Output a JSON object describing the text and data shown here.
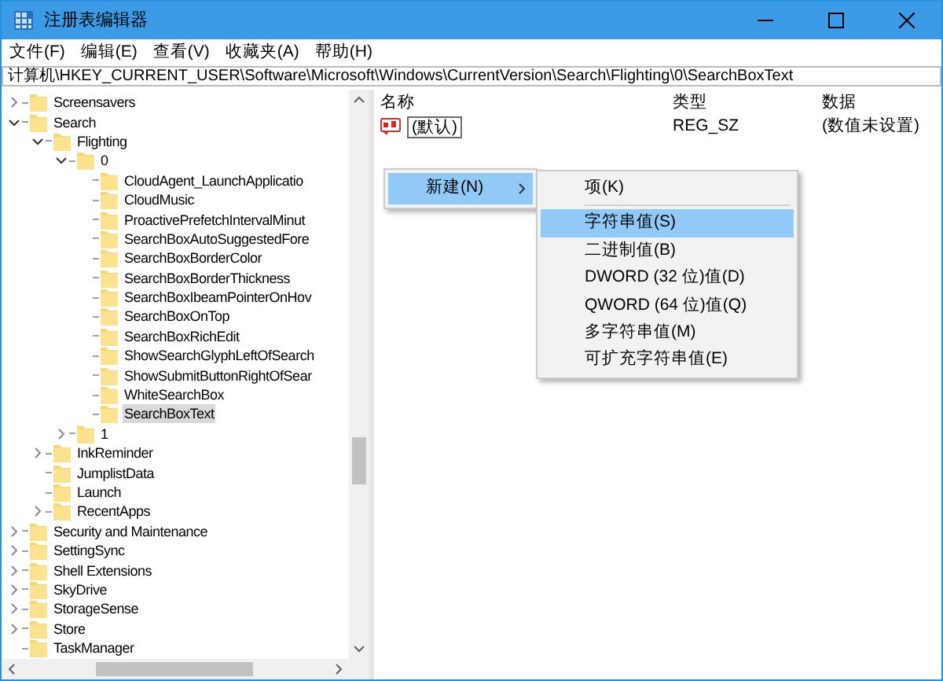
{
  "window": {
    "title": "注册表编辑器"
  },
  "menu_bar": [
    "文件(F)",
    "编辑(E)",
    "查看(V)",
    "收藏夹(A)",
    "帮助(H)"
  ],
  "address": "计算机\\HKEY_CURRENT_USER\\Software\\Microsoft\\Windows\\CurrentVersion\\Search\\Flighting\\0\\SearchBoxText",
  "tree": [
    {
      "label": "Screensavers",
      "expanded": false,
      "selected": false
    },
    {
      "label": "Search",
      "expanded": true,
      "selected": false,
      "children": [
        {
          "label": "Flighting",
          "expanded": true,
          "selected": false,
          "children": [
            {
              "label": "0",
              "expanded": true,
              "selected": false,
              "children": [
                {
                  "label": "CloudAgent_LaunchApplicatio",
                  "selected": false
                },
                {
                  "label": "CloudMusic",
                  "selected": false
                },
                {
                  "label": "ProactivePrefetchIntervalMinut",
                  "selected": false
                },
                {
                  "label": "SearchBoxAutoSuggestedFore",
                  "selected": false
                },
                {
                  "label": "SearchBoxBorderColor",
                  "selected": false
                },
                {
                  "label": "SearchBoxBorderThickness",
                  "selected": false
                },
                {
                  "label": "SearchBoxIbeamPointerOnHov",
                  "selected": false
                },
                {
                  "label": "SearchBoxOnTop",
                  "selected": false
                },
                {
                  "label": "SearchBoxRichEdit",
                  "selected": false
                },
                {
                  "label": "ShowSearchGlyphLeftOfSearch",
                  "selected": false
                },
                {
                  "label": "ShowSubmitButtonRightOfSear",
                  "selected": false
                },
                {
                  "label": "WhiteSearchBox",
                  "selected": false
                },
                {
                  "label": "SearchBoxText",
                  "selected": true
                }
              ]
            },
            {
              "label": "1",
              "expanded": false,
              "selected": false
            }
          ]
        },
        {
          "label": "InkReminder",
          "expanded": false,
          "selected": false
        },
        {
          "label": "JumplistData",
          "selected": false
        },
        {
          "label": "Launch",
          "selected": false
        },
        {
          "label": "RecentApps",
          "expanded": false,
          "selected": false
        }
      ]
    },
    {
      "label": "Security and Maintenance",
      "expanded": false,
      "selected": false
    },
    {
      "label": "SettingSync",
      "expanded": false,
      "selected": false
    },
    {
      "label": "Shell Extensions",
      "expanded": false,
      "selected": false
    },
    {
      "label": "SkyDrive",
      "expanded": false,
      "selected": false
    },
    {
      "label": "StorageSense",
      "expanded": false,
      "selected": false
    },
    {
      "label": "Store",
      "expanded": false,
      "selected": false
    },
    {
      "label": "TaskManager",
      "selected": false
    }
  ],
  "table": {
    "columns": [
      "名称",
      "类型",
      "数据"
    ],
    "rows": [
      [
        "(默认)",
        "REG_SZ",
        "(数值未设置)"
      ]
    ]
  },
  "context_menu": {
    "items": [
      {
        "label": "新建(N)",
        "selected": true
      }
    ]
  },
  "submenu": {
    "items": [
      {
        "label": "项(K)",
        "selected": false,
        "divider_after": true
      },
      {
        "label": "字符串值(S)",
        "selected": true,
        "divider_after": false
      },
      {
        "label": "二进制值(B)",
        "selected": false,
        "divider_after": false
      },
      {
        "label": "DWORD (32 位)值(D)",
        "selected": false,
        "divider_after": false
      },
      {
        "label": "QWORD (64 位)值(Q)",
        "selected": false,
        "divider_after": false
      },
      {
        "label": "多字符串值(M)",
        "selected": false,
        "divider_after": false
      },
      {
        "label": "可扩充字符串值(E)",
        "selected": false,
        "divider_after": false
      }
    ]
  }
}
